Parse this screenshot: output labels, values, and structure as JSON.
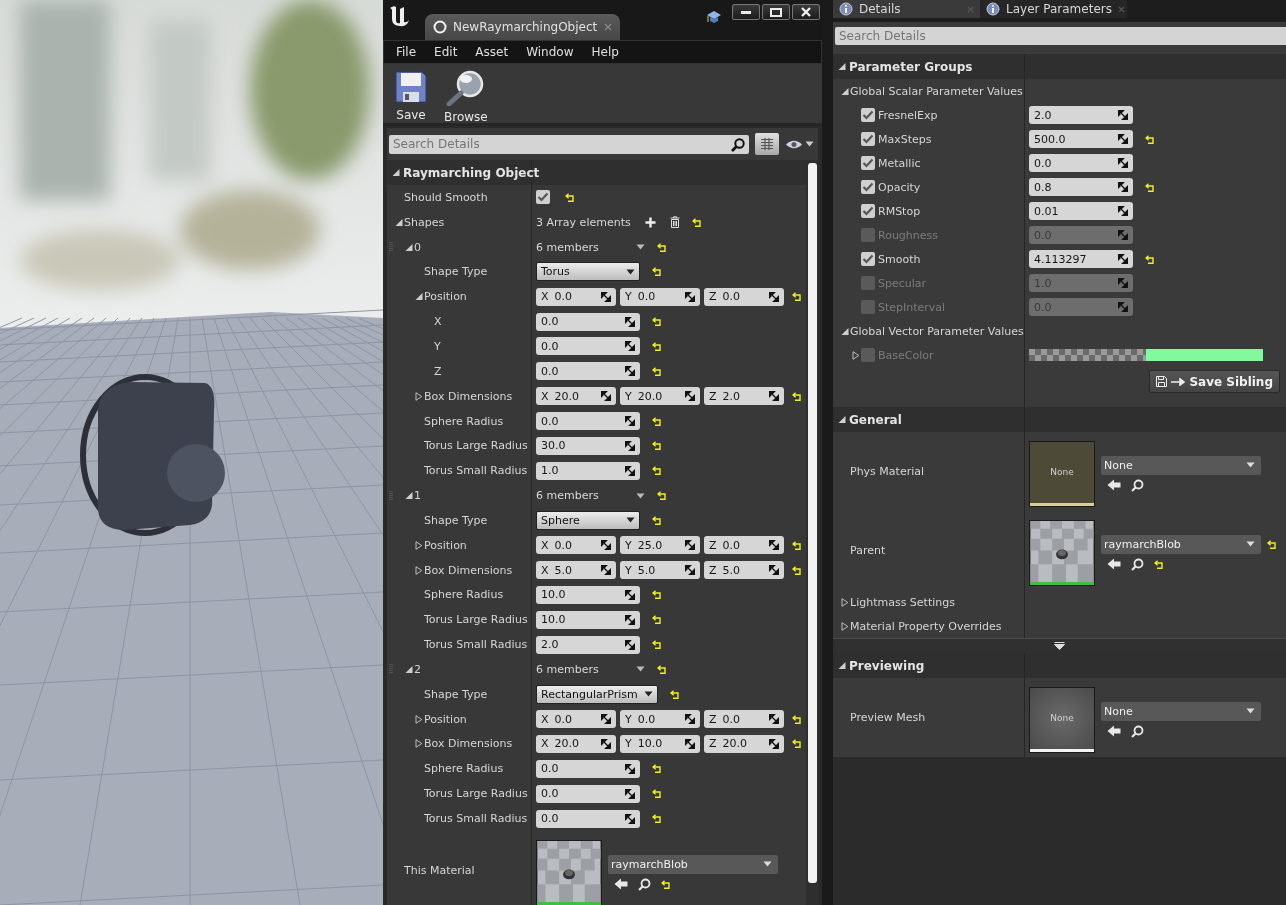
{
  "editor": {
    "document_tab": {
      "title": "NewRaymarchingObject"
    },
    "menu": [
      "File",
      "Edit",
      "Asset",
      "Window",
      "Help"
    ],
    "toolbar": [
      {
        "kind": "save",
        "label": "Save"
      },
      {
        "kind": "browse",
        "label": "Browse"
      }
    ],
    "details": {
      "search_placeholder": "Search Details",
      "rows": [
        {
          "kind": "category",
          "label": "Raymarching Object",
          "expanded": true,
          "children": [
            {
              "kind": "check",
              "label": "Should Smooth",
              "checked": true,
              "reset": true
            },
            {
              "kind": "array",
              "label": "Shapes",
              "expanded": true,
              "value": "3 Array elements",
              "reset": true,
              "children": [
                {
                  "kind": "struct",
                  "label": "0",
                  "expanded": true,
                  "value": "6 members",
                  "reset": true,
                  "children": [
                    {
                      "kind": "enum",
                      "label": "Shape Type",
                      "value": "Torus",
                      "reset": true
                    },
                    {
                      "kind": "vector",
                      "label": "Position",
                      "expanded": true,
                      "reset": true,
                      "components": [
                        {
                          "axis": "X",
                          "value": "0.0"
                        },
                        {
                          "axis": "Y",
                          "value": "0.0"
                        },
                        {
                          "axis": "Z",
                          "value": "0.0"
                        }
                      ],
                      "children": [
                        {
                          "kind": "number",
                          "label": "X",
                          "value": "0.0",
                          "reset": true
                        },
                        {
                          "kind": "number",
                          "label": "Y",
                          "value": "0.0",
                          "reset": true
                        },
                        {
                          "kind": "number",
                          "label": "Z",
                          "value": "0.0",
                          "reset": true
                        }
                      ]
                    },
                    {
                      "kind": "vector",
                      "label": "Box Dimensions",
                      "expanded": false,
                      "reset": true,
                      "components": [
                        {
                          "axis": "X",
                          "value": "20.0"
                        },
                        {
                          "axis": "Y",
                          "value": "20.0"
                        },
                        {
                          "axis": "Z",
                          "value": "2.0"
                        }
                      ]
                    },
                    {
                      "kind": "number",
                      "label": "Sphere Radius",
                      "value": "0.0",
                      "reset": true
                    },
                    {
                      "kind": "number",
                      "label": "Torus Large Radius",
                      "value": "30.0",
                      "reset": true
                    },
                    {
                      "kind": "number",
                      "label": "Torus Small Radius",
                      "value": "1.0",
                      "reset": true
                    }
                  ]
                },
                {
                  "kind": "struct",
                  "label": "1",
                  "expanded": true,
                  "value": "6 members",
                  "reset": true,
                  "children": [
                    {
                      "kind": "enum",
                      "label": "Shape Type",
                      "value": "Sphere",
                      "reset": true
                    },
                    {
                      "kind": "vector",
                      "label": "Position",
                      "expanded": false,
                      "reset": true,
                      "components": [
                        {
                          "axis": "X",
                          "value": "0.0"
                        },
                        {
                          "axis": "Y",
                          "value": "25.0"
                        },
                        {
                          "axis": "Z",
                          "value": "0.0"
                        }
                      ]
                    },
                    {
                      "kind": "vector",
                      "label": "Box Dimensions",
                      "expanded": false,
                      "reset": true,
                      "components": [
                        {
                          "axis": "X",
                          "value": "5.0"
                        },
                        {
                          "axis": "Y",
                          "value": "5.0"
                        },
                        {
                          "axis": "Z",
                          "value": "5.0"
                        }
                      ]
                    },
                    {
                      "kind": "number",
                      "label": "Sphere Radius",
                      "value": "10.0",
                      "reset": true
                    },
                    {
                      "kind": "number",
                      "label": "Torus Large Radius",
                      "value": "10.0",
                      "reset": true
                    },
                    {
                      "kind": "number",
                      "label": "Torus Small Radius",
                      "value": "2.0",
                      "reset": true
                    }
                  ]
                },
                {
                  "kind": "struct",
                  "label": "2",
                  "expanded": true,
                  "value": "6 members",
                  "reset": true,
                  "children": [
                    {
                      "kind": "enum",
                      "label": "Shape Type",
                      "value": "RectangularPrism",
                      "reset": true
                    },
                    {
                      "kind": "vector",
                      "label": "Position",
                      "expanded": false,
                      "reset": true,
                      "components": [
                        {
                          "axis": "X",
                          "value": "0.0"
                        },
                        {
                          "axis": "Y",
                          "value": "0.0"
                        },
                        {
                          "axis": "Z",
                          "value": "0.0"
                        }
                      ]
                    },
                    {
                      "kind": "vector",
                      "label": "Box Dimensions",
                      "expanded": false,
                      "reset": true,
                      "components": [
                        {
                          "axis": "X",
                          "value": "20.0"
                        },
                        {
                          "axis": "Y",
                          "value": "10.0"
                        },
                        {
                          "axis": "Z",
                          "value": "20.0"
                        }
                      ]
                    },
                    {
                      "kind": "number",
                      "label": "Sphere Radius",
                      "value": "0.0",
                      "reset": true
                    },
                    {
                      "kind": "number",
                      "label": "Torus Large Radius",
                      "value": "0.0",
                      "reset": true
                    },
                    {
                      "kind": "number",
                      "label": "Torus Small Radius",
                      "value": "0.0",
                      "reset": true
                    }
                  ]
                }
              ]
            },
            {
              "kind": "asset",
              "label": "This Material",
              "thumbnail": {
                "kind": "material"
              },
              "value": "raymarchBlob",
              "reset": true,
              "dropdown_reset": false
            }
          ]
        }
      ]
    }
  },
  "material_panel": {
    "tabs": [
      {
        "label": "Details",
        "selected": true
      },
      {
        "label": "Layer Parameters",
        "selected": false
      }
    ],
    "search_placeholder": "Search Details",
    "categories": [
      {
        "label": "Parameter Groups",
        "expanded": true,
        "splitter": false,
        "rows": [
          {
            "kind": "group",
            "label": "Global Scalar Parameter Values",
            "expanded": true,
            "children": [
              {
                "kind": "scalar",
                "label": "FresnelExp",
                "checked": true,
                "value": "2.0",
                "reset": false
              },
              {
                "kind": "scalar",
                "label": "MaxSteps",
                "checked": true,
                "value": "500.0",
                "reset": true
              },
              {
                "kind": "scalar",
                "label": "Metallic",
                "checked": true,
                "value": "0.0",
                "reset": false
              },
              {
                "kind": "scalar",
                "label": "Opacity",
                "checked": true,
                "value": "0.8",
                "reset": true
              },
              {
                "kind": "scalar",
                "label": "RMStop",
                "checked": true,
                "value": "0.01",
                "reset": false
              },
              {
                "kind": "scalar",
                "label": "Roughness",
                "checked": false,
                "value": "0.0",
                "reset": false
              },
              {
                "kind": "scalar",
                "label": "Smooth",
                "checked": true,
                "value": "4.113297",
                "reset": true
              },
              {
                "kind": "scalar",
                "label": "Specular",
                "checked": false,
                "value": "1.0",
                "reset": false
              },
              {
                "kind": "scalar",
                "label": "StepInterval",
                "checked": false,
                "value": "0.0",
                "reset": false
              }
            ]
          },
          {
            "kind": "group",
            "label": "Global Vector Parameter Values",
            "expanded": true,
            "children": [
              {
                "kind": "color",
                "label": "BaseColor",
                "checked": false,
                "expanded": false,
                "color": "#80fa9c"
              }
            ]
          },
          {
            "kind": "button",
            "label": "Save Sibling"
          }
        ]
      },
      {
        "label": "General",
        "expanded": true,
        "splitter": false,
        "rows": [
          {
            "kind": "asset",
            "label": "Phys Material",
            "thumbnail": {
              "kind": "physical-material",
              "label": "None"
            },
            "value": "None",
            "reset": false,
            "dropdown_reset": false
          },
          {
            "kind": "asset",
            "label": "Parent",
            "thumbnail": {
              "kind": "material"
            },
            "value": "raymarchBlob",
            "reset": true,
            "dropdown_reset": true
          },
          {
            "kind": "group",
            "label": "Lightmass Settings",
            "expanded": false
          },
          {
            "kind": "group",
            "label": "Material Property Overrides",
            "expanded": false
          }
        ]
      },
      {
        "label": "Previewing",
        "expanded": true,
        "splitter": true,
        "rows": [
          {
            "kind": "asset",
            "label": "Preview Mesh",
            "thumbnail": {
              "kind": "mesh",
              "label": "None"
            },
            "value": "None",
            "reset": false,
            "dropdown_reset": false
          }
        ]
      }
    ]
  }
}
